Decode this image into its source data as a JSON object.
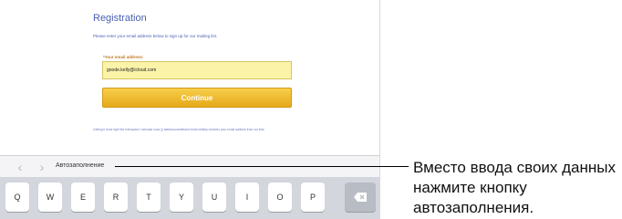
{
  "page": {
    "title": "Registration",
    "subtitle": "Please enter your email address below to sign up for our mailing list.",
    "email_label": "*Your email address:",
    "email_value": "goode.kelly@icloud.com",
    "continue_label": "Continue",
    "fineprint": "Getting it done right the Interoperm Calendar uses ||| balk/mouseretbash email reliably receives your email address from our lists."
  },
  "toolbar": {
    "back_icon": "chevron-left",
    "forward_icon": "chevron-right",
    "autofill_label": "Автозаполнение"
  },
  "keyboard": {
    "keys": [
      "Q",
      "W",
      "E",
      "R",
      "T",
      "Y",
      "U",
      "I",
      "O",
      "P"
    ],
    "delete_icon": "backspace"
  },
  "callout": {
    "text": "Вместо ввода своих данных нажмите кнопку автозаполнения."
  },
  "colors": {
    "title": "#4a5fb4",
    "field_bg": "#fbf3a8",
    "button": "#f0bb2c",
    "keyboard_bg": "#d3d6dc"
  }
}
